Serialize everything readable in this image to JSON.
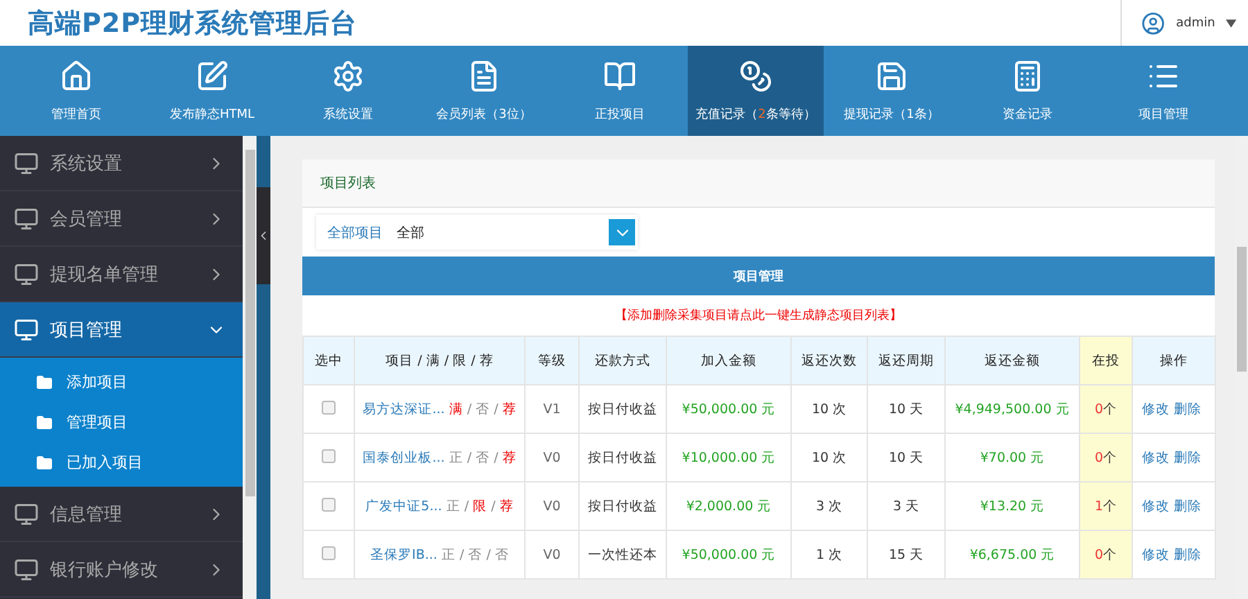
{
  "header": {
    "title": "高端P2P理财系统管理后台",
    "user": "admin"
  },
  "nav": [
    {
      "kind": "home",
      "label_parts": [
        "管理首页"
      ],
      "selected": false
    },
    {
      "kind": "publish",
      "label_parts": [
        "发布静态HTML"
      ],
      "selected": false
    },
    {
      "kind": "settings",
      "label_parts": [
        "系统设置"
      ],
      "selected": false
    },
    {
      "kind": "members",
      "label_parts": [
        "会员列表（3位）"
      ],
      "selected": false
    },
    {
      "kind": "book",
      "label_parts": [
        "正投项目"
      ],
      "selected": false
    },
    {
      "kind": "coins",
      "label_parts": [
        "充值记录（",
        "2",
        "条等待）"
      ],
      "selected": true
    },
    {
      "kind": "save",
      "label_parts": [
        "提现记录（1条）"
      ],
      "selected": false
    },
    {
      "kind": "calculator",
      "label_parts": [
        "资金记录"
      ],
      "selected": false
    },
    {
      "kind": "list",
      "label_parts": [
        "项目管理"
      ],
      "selected": false
    }
  ],
  "sidebar": {
    "items": [
      {
        "label": "系统设置",
        "expanded": false
      },
      {
        "label": "会员管理",
        "expanded": false
      },
      {
        "label": "提现名单管理",
        "expanded": false
      },
      {
        "label": "项目管理",
        "expanded": true,
        "children": [
          {
            "label": "添加项目"
          },
          {
            "label": "管理项目"
          },
          {
            "label": "已加入项目"
          }
        ]
      },
      {
        "label": "信息管理",
        "expanded": false
      },
      {
        "label": "银行账户修改",
        "expanded": false
      }
    ]
  },
  "panel": {
    "title": "项目列表",
    "filter": {
      "label": "全部项目",
      "value": "全部"
    },
    "table": {
      "title": "项目管理",
      "notice": "【添加删除采集项目请点此一键生成静态项目列表】",
      "columns": [
        "选中",
        "项目 / 满 / 限 / 荐",
        "等级",
        "还款方式",
        "加入金额",
        "返还次数",
        "返还周期",
        "返还金额",
        "在投",
        "操作"
      ],
      "rows": [
        {
          "selected": false,
          "name": "易方达深证...",
          "flags": [
            {
              "label": "满",
              "on": true,
              "after": "/"
            },
            {
              "label": "否",
              "on": false,
              "after": "/"
            },
            {
              "label": "荐",
              "on": true
            }
          ],
          "level": "V1",
          "method": "按日付收益",
          "amount": "¥50,000.00 元",
          "times": "10 次",
          "period": "10 天",
          "returns": "¥4,949,500.00 元",
          "count": "0",
          "unit": "个",
          "actions": [
            "修改",
            "删除"
          ]
        },
        {
          "selected": false,
          "name": "国泰创业板...",
          "flags": [
            {
              "label": "正",
              "on": false,
              "after": "/"
            },
            {
              "label": "否",
              "on": false,
              "after": "/"
            },
            {
              "label": "荐",
              "on": true
            }
          ],
          "level": "V0",
          "method": "按日付收益",
          "amount": "¥10,000.00 元",
          "times": "10 次",
          "period": "10 天",
          "returns": "¥70.00 元",
          "count": "0",
          "unit": "个",
          "actions": [
            "修改",
            "删除"
          ]
        },
        {
          "selected": false,
          "name": "广发中证5...",
          "flags": [
            {
              "label": "正",
              "on": false,
              "after": "/"
            },
            {
              "label": "限",
              "on": true,
              "after": "/"
            },
            {
              "label": "荐",
              "on": true
            }
          ],
          "level": "V0",
          "method": "按日付收益",
          "amount": "¥2,000.00 元",
          "times": "3 次",
          "period": "3 天",
          "returns": "¥13.20 元",
          "count": "1",
          "unit": "个",
          "actions": [
            "修改",
            "删除"
          ]
        },
        {
          "selected": false,
          "name": "圣保罗IB...",
          "flags": [
            {
              "label": "正",
              "on": false,
              "after": "/"
            },
            {
              "label": "否",
              "on": false,
              "after": "/"
            },
            {
              "label": "否",
              "on": false
            }
          ],
          "level": "V0",
          "method": "一次性还本",
          "amount": "¥50,000.00 元",
          "times": "1 次",
          "period": "15 天",
          "returns": "¥6,675.00 元",
          "count": "0",
          "unit": "个",
          "actions": [
            "修改",
            "删除"
          ]
        }
      ]
    }
  }
}
